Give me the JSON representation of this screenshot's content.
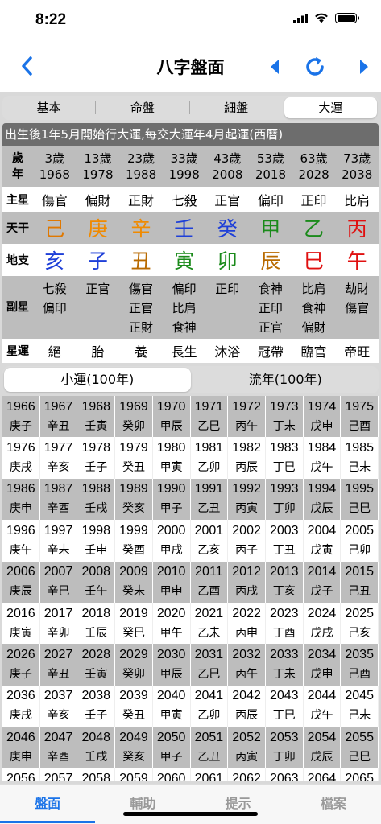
{
  "status": {
    "time": "8:22"
  },
  "nav": {
    "title": "八字盤面"
  },
  "segments": [
    "基本",
    "命盤",
    "細盤",
    "大運"
  ],
  "header_text": "出生後1年5月開始行大運,每交大運年4月起運(西曆)",
  "labels": {
    "age": [
      "歲",
      "年"
    ],
    "star": "主星",
    "gan": "天干",
    "zhi": "地支",
    "fu": "副星",
    "yun": "星運"
  },
  "dayun": [
    {
      "age": "3歲",
      "year": "1968",
      "star": "傷官",
      "gan": "己",
      "gan_color": "#e07800",
      "zhi": "亥",
      "zhi_color": "#1e3fd8",
      "fu": [
        "七殺",
        "偏印"
      ],
      "yun": "絕"
    },
    {
      "age": "13歲",
      "year": "1978",
      "star": "偏財",
      "gan": "庚",
      "gan_color": "#f08a00",
      "zhi": "子",
      "zhi_color": "#1e3fd8",
      "fu": [
        "正官"
      ],
      "yun": "胎"
    },
    {
      "age": "23歲",
      "year": "1988",
      "star": "正財",
      "gan": "辛",
      "gan_color": "#f08a00",
      "zhi": "丑",
      "zhi_color": "#b86a00",
      "fu": [
        "傷官",
        "正官",
        "正財"
      ],
      "yun": "養"
    },
    {
      "age": "33歲",
      "year": "1998",
      "star": "七殺",
      "gan": "壬",
      "gan_color": "#1e3fd8",
      "zhi": "寅",
      "zhi_color": "#1a8a1a",
      "fu": [
        "偏印",
        "比肩",
        "食神"
      ],
      "yun": "長生"
    },
    {
      "age": "43歲",
      "year": "2008",
      "star": "正官",
      "gan": "癸",
      "gan_color": "#1e3fd8",
      "zhi": "卯",
      "zhi_color": "#1a8a1a",
      "fu": [
        "正印"
      ],
      "yun": "沐浴"
    },
    {
      "age": "53歲",
      "year": "2018",
      "star": "偏印",
      "gan": "甲",
      "gan_color": "#1a8a1a",
      "zhi": "辰",
      "zhi_color": "#b86a00",
      "fu": [
        "食神",
        "正印",
        "正官"
      ],
      "yun": "冠帶"
    },
    {
      "age": "63歲",
      "year": "2028",
      "star": "正印",
      "gan": "乙",
      "gan_color": "#1a8a1a",
      "zhi": "巳",
      "zhi_color": "#e01010",
      "fu": [
        "比肩",
        "食神",
        "偏財"
      ],
      "yun": "臨官"
    },
    {
      "age": "73歲",
      "year": "2038",
      "star": "比肩",
      "gan": "丙",
      "gan_color": "#e01010",
      "zhi": "午",
      "zhi_color": "#e01010",
      "fu": [
        "劫財",
        "傷官"
      ],
      "yun": "帝旺"
    }
  ],
  "seg2": [
    "小運(100年)",
    "流年(100年)"
  ],
  "years": [
    [
      [
        "1966",
        "庚子"
      ],
      [
        "1967",
        "辛丑"
      ],
      [
        "1968",
        "壬寅"
      ],
      [
        "1969",
        "癸卯"
      ],
      [
        "1970",
        "甲辰"
      ],
      [
        "1971",
        "乙巳"
      ],
      [
        "1972",
        "丙午"
      ],
      [
        "1973",
        "丁未"
      ],
      [
        "1974",
        "戊申"
      ],
      [
        "1975",
        "己酉"
      ]
    ],
    [
      [
        "1976",
        "庚戌"
      ],
      [
        "1977",
        "辛亥"
      ],
      [
        "1978",
        "壬子"
      ],
      [
        "1979",
        "癸丑"
      ],
      [
        "1980",
        "甲寅"
      ],
      [
        "1981",
        "乙卯"
      ],
      [
        "1982",
        "丙辰"
      ],
      [
        "1983",
        "丁巳"
      ],
      [
        "1984",
        "戊午"
      ],
      [
        "1985",
        "己未"
      ]
    ],
    [
      [
        "1986",
        "庚申"
      ],
      [
        "1987",
        "辛酉"
      ],
      [
        "1988",
        "壬戌"
      ],
      [
        "1989",
        "癸亥"
      ],
      [
        "1990",
        "甲子"
      ],
      [
        "1991",
        "乙丑"
      ],
      [
        "1992",
        "丙寅"
      ],
      [
        "1993",
        "丁卯"
      ],
      [
        "1994",
        "戊辰"
      ],
      [
        "1995",
        "己巳"
      ]
    ],
    [
      [
        "1996",
        "庚午"
      ],
      [
        "1997",
        "辛未"
      ],
      [
        "1998",
        "壬申"
      ],
      [
        "1999",
        "癸酉"
      ],
      [
        "2000",
        "甲戌"
      ],
      [
        "2001",
        "乙亥"
      ],
      [
        "2002",
        "丙子"
      ],
      [
        "2003",
        "丁丑"
      ],
      [
        "2004",
        "戊寅"
      ],
      [
        "2005",
        "己卯"
      ]
    ],
    [
      [
        "2006",
        "庚辰"
      ],
      [
        "2007",
        "辛巳"
      ],
      [
        "2008",
        "壬午"
      ],
      [
        "2009",
        "癸未"
      ],
      [
        "2010",
        "甲申"
      ],
      [
        "2011",
        "乙酉"
      ],
      [
        "2012",
        "丙戌"
      ],
      [
        "2013",
        "丁亥"
      ],
      [
        "2014",
        "戊子"
      ],
      [
        "2015",
        "己丑"
      ]
    ],
    [
      [
        "2016",
        "庚寅"
      ],
      [
        "2017",
        "辛卯"
      ],
      [
        "2018",
        "壬辰"
      ],
      [
        "2019",
        "癸巳"
      ],
      [
        "2020",
        "甲午"
      ],
      [
        "2021",
        "乙未"
      ],
      [
        "2022",
        "丙申"
      ],
      [
        "2023",
        "丁酉"
      ],
      [
        "2024",
        "戊戌"
      ],
      [
        "2025",
        "己亥"
      ]
    ],
    [
      [
        "2026",
        "庚子"
      ],
      [
        "2027",
        "辛丑"
      ],
      [
        "2028",
        "壬寅"
      ],
      [
        "2029",
        "癸卯"
      ],
      [
        "2030",
        "甲辰"
      ],
      [
        "2031",
        "乙巳"
      ],
      [
        "2032",
        "丙午"
      ],
      [
        "2033",
        "丁未"
      ],
      [
        "2034",
        "戊申"
      ],
      [
        "2035",
        "己酉"
      ]
    ],
    [
      [
        "2036",
        "庚戌"
      ],
      [
        "2037",
        "辛亥"
      ],
      [
        "2038",
        "壬子"
      ],
      [
        "2039",
        "癸丑"
      ],
      [
        "2040",
        "甲寅"
      ],
      [
        "2041",
        "乙卯"
      ],
      [
        "2042",
        "丙辰"
      ],
      [
        "2043",
        "丁巳"
      ],
      [
        "2044",
        "戊午"
      ],
      [
        "2045",
        "己未"
      ]
    ],
    [
      [
        "2046",
        "庚申"
      ],
      [
        "2047",
        "辛酉"
      ],
      [
        "2048",
        "壬戌"
      ],
      [
        "2049",
        "癸亥"
      ],
      [
        "2050",
        "甲子"
      ],
      [
        "2051",
        "乙丑"
      ],
      [
        "2052",
        "丙寅"
      ],
      [
        "2053",
        "丁卯"
      ],
      [
        "2054",
        "戊辰"
      ],
      [
        "2055",
        "己巳"
      ]
    ],
    [
      [
        "2056",
        "庚午"
      ],
      [
        "2057",
        "辛未"
      ],
      [
        "2058",
        "壬申"
      ],
      [
        "2059",
        "癸酉"
      ],
      [
        "2060",
        "甲戌"
      ],
      [
        "2061",
        "乙亥"
      ],
      [
        "2062",
        "丙子"
      ],
      [
        "2063",
        "丁丑"
      ],
      [
        "2064",
        "戊寅"
      ],
      [
        "2065",
        "己卯"
      ]
    ]
  ],
  "tabs": [
    "盤面",
    "輔助",
    "提示",
    "檔案"
  ],
  "colors": {
    "accent": "#1a73e8"
  }
}
